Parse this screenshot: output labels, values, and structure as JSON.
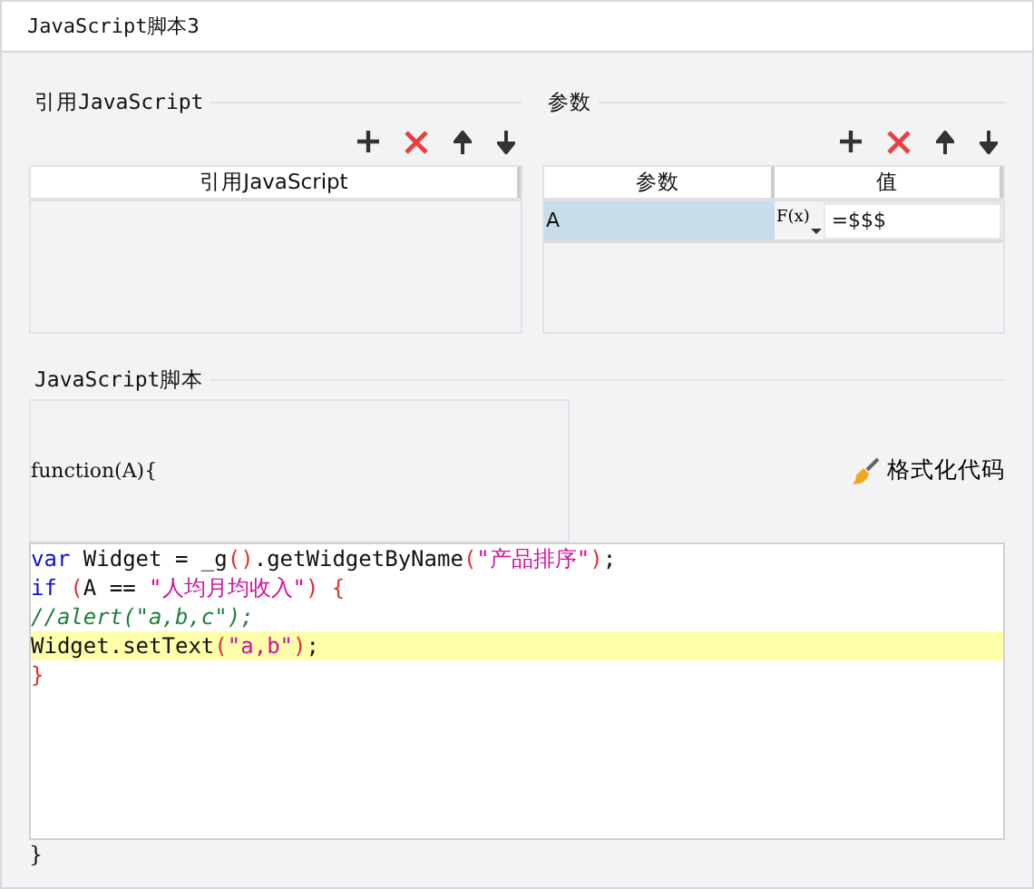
{
  "window": {
    "title": "JavaScript脚本3"
  },
  "references": {
    "title": "引用JavaScript",
    "toolbar": [
      {
        "kind": "add"
      },
      {
        "kind": "delete"
      },
      {
        "kind": "up"
      },
      {
        "kind": "down"
      }
    ],
    "columns": [
      "引用JavaScript"
    ]
  },
  "parameters": {
    "title": "参数",
    "toolbar": [
      {
        "kind": "add"
      },
      {
        "kind": "delete"
      },
      {
        "kind": "up"
      },
      {
        "kind": "down"
      }
    ],
    "columns": [
      "参数",
      "值"
    ],
    "rows": [
      {
        "name": "A",
        "selected": true,
        "formula_label": "F(x)",
        "value": "=$$$"
      }
    ]
  },
  "script": {
    "title": "JavaScript脚本",
    "signature": "function(A){",
    "format_button": "格式化代码",
    "lines": [
      {
        "highlighted": false,
        "tokens": [
          {
            "kind": "keyword",
            "text": "var"
          },
          {
            "kind": "plain",
            "text": " Widget = _g"
          },
          {
            "kind": "paren",
            "text": "()"
          },
          {
            "kind": "plain",
            "text": ".getWidgetByName"
          },
          {
            "kind": "paren",
            "text": "("
          },
          {
            "kind": "string",
            "text": "\"产品排序\""
          },
          {
            "kind": "paren",
            "text": ")"
          },
          {
            "kind": "plain",
            "text": ";"
          }
        ]
      },
      {
        "highlighted": false,
        "tokens": [
          {
            "kind": "keyword",
            "text": "if"
          },
          {
            "kind": "paren",
            "text": " ("
          },
          {
            "kind": "plain",
            "text": "A == "
          },
          {
            "kind": "string",
            "text": "\"人均月均收入\""
          },
          {
            "kind": "paren",
            "text": ") {"
          }
        ]
      },
      {
        "highlighted": false,
        "tokens": [
          {
            "kind": "comment",
            "text": "//alert(\"a,b,c\");"
          }
        ]
      },
      {
        "highlighted": true,
        "tokens": [
          {
            "kind": "plain",
            "text": "Widget.setText"
          },
          {
            "kind": "paren",
            "text": "("
          },
          {
            "kind": "string",
            "text": "\"a,b\""
          },
          {
            "kind": "paren",
            "text": ")"
          },
          {
            "kind": "plain",
            "text": ";"
          }
        ]
      },
      {
        "highlighted": false,
        "tokens": [
          {
            "kind": "paren",
            "text": "}"
          }
        ]
      }
    ],
    "closing": "}"
  }
}
